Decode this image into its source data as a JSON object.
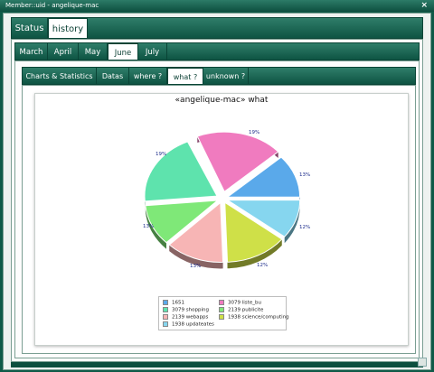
{
  "window": {
    "title": "Member::uid - angelique-mac",
    "close": "×"
  },
  "main_tabs": [
    {
      "label": "Status",
      "active": false
    },
    {
      "label": "history",
      "active": true
    }
  ],
  "month_tabs": [
    {
      "label": "March",
      "active": false
    },
    {
      "label": "April",
      "active": false
    },
    {
      "label": "May",
      "active": false
    },
    {
      "label": "June",
      "active": true
    },
    {
      "label": "July",
      "active": false
    }
  ],
  "view_tabs": [
    {
      "label": "Charts & Statistics",
      "active": false
    },
    {
      "label": "Datas",
      "active": false
    },
    {
      "label": "where ?",
      "active": false
    },
    {
      "label": "what ?",
      "active": true
    },
    {
      "label": "unknown ?",
      "active": false
    }
  ],
  "chart_data": {
    "type": "pie",
    "title": "«angelique-mac» what",
    "slices": [
      {
        "label": "1651",
        "percent_label": "13%",
        "color": "#5aa9ea"
      },
      {
        "label": "3079 liste_bu",
        "percent_label": "19%",
        "color": "#f07bbf"
      },
      {
        "label": "3079 shopping",
        "percent_label": "19%",
        "color": "#5ee3ad"
      },
      {
        "label": "2139 publicite",
        "percent_label": "13%",
        "color": "#7fe878"
      },
      {
        "label": "2139 webapps",
        "percent_label": "13%",
        "color": "#f7b5b5"
      },
      {
        "label": "1938 science/computing",
        "percent_label": "12%",
        "color": "#cfe048"
      },
      {
        "label": "1938 updateates",
        "percent_label": "12%",
        "color": "#86d6ef"
      }
    ]
  }
}
